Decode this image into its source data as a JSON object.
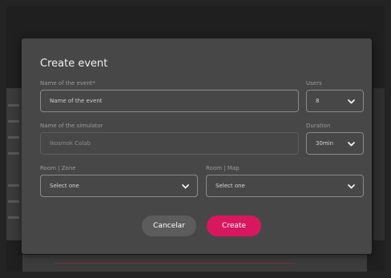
{
  "modal": {
    "title": "Create event",
    "event_name": {
      "label": "Name of the event*",
      "placeholder": "Name of the event"
    },
    "users": {
      "label": "Users",
      "value": "8",
      "icon": "chevron-down-icon"
    },
    "simulator": {
      "label": "Name of the simulator",
      "placeholder": "Ikosmok Colab"
    },
    "duration": {
      "label": "Duration",
      "value": "30min",
      "icon": "chevron-down-icon"
    },
    "room_zone": {
      "label": "Room | Zone",
      "value": "Select one",
      "icon": "chevron-down-icon"
    },
    "room_map": {
      "label": "Room | Map",
      "value": "Select one",
      "icon": "chevron-down-icon"
    },
    "buttons": {
      "cancel": "Cancelar",
      "create": "Create"
    }
  },
  "colors": {
    "overlay_bg": "#232323",
    "modal_bg": "#474747",
    "accent": "#d8175f",
    "secondary_button": "#5c5c5c"
  }
}
